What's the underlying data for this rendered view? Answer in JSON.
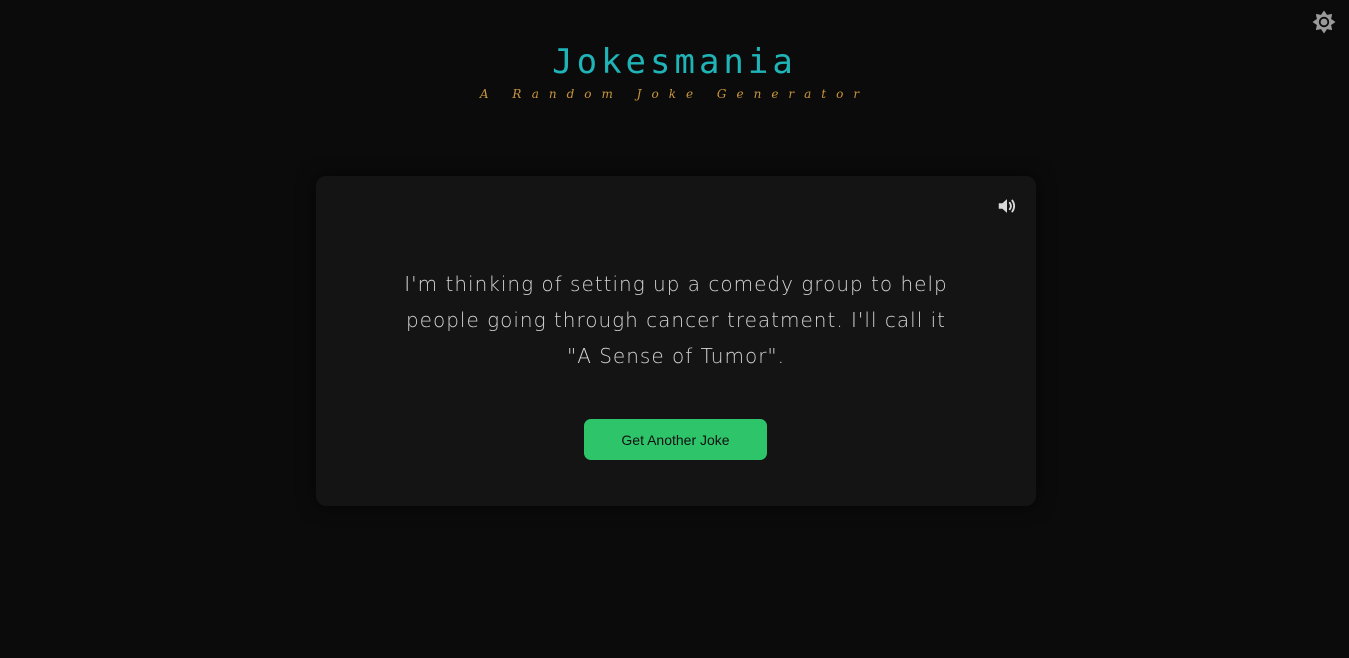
{
  "app": {
    "title": "Jokesmania",
    "subtitle": "A Random Joke Generator"
  },
  "joke": {
    "text": "I'm thinking of setting up a comedy group to help people going through cancer treatment. I'll call it \"A Sense of Tumor\"."
  },
  "actions": {
    "next_joke_label": "Get Another Joke"
  },
  "icons": {
    "theme_toggle": "sun-icon",
    "speak": "speaker-icon"
  },
  "colors": {
    "background": "#0b0b0b",
    "card": "#141414",
    "title": "#1fb5b8",
    "subtitle": "#c8953c",
    "button": "#2ec56a",
    "text": "#d4d4d4"
  }
}
